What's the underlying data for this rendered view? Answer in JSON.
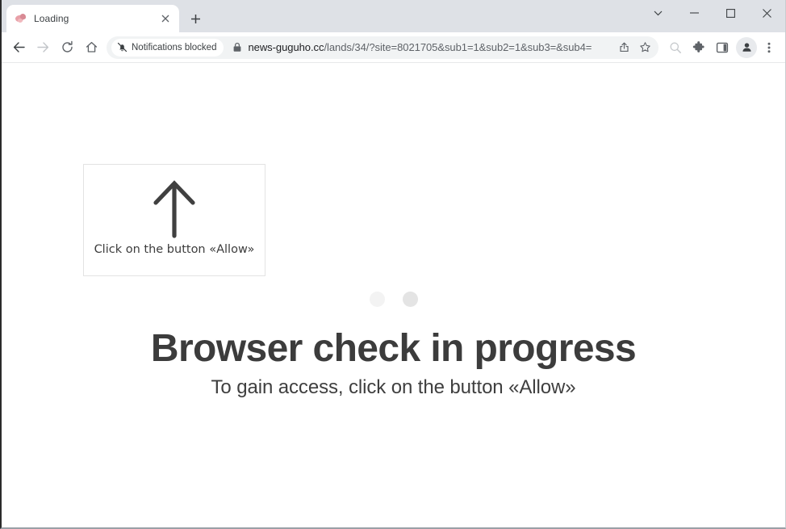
{
  "window": {
    "controls": {
      "tab_search_label": "Search tabs",
      "minimize_label": "Minimize",
      "maximize_label": "Maximize",
      "close_label": "Close"
    }
  },
  "tabstrip": {
    "tabs": [
      {
        "title": "Loading",
        "favicon": "site-favicon",
        "close_label": "Close tab"
      }
    ],
    "new_tab_label": "New Tab"
  },
  "toolbar": {
    "back_label": "Back",
    "forward_label": "Forward",
    "reload_label": "Reload",
    "home_label": "Home",
    "share_label": "Share this page",
    "bookmark_label": "Bookmark this tab",
    "search_label": "Search",
    "extensions_label": "Extensions",
    "side_panel_label": "Side panel",
    "profile_label": "Profile",
    "menu_label": "Customize and control Google Chrome"
  },
  "omnibox": {
    "notifications_chip": "Notifications blocked",
    "notifications_icon": "bell-slash-icon",
    "security_icon": "lock-icon",
    "url_host": "news-guguho.cc",
    "url_path": "/lands/34/?site=8021705&sub1=1&sub2=1&sub3=&sub4=",
    "url_full": "news-guguho.cc/lands/34/?site=8021705&sub1=1&sub2=1&sub3=&sub4="
  },
  "page": {
    "allow_box": {
      "arrow_icon": "arrow-up-icon",
      "caption": "Click on the button «Allow»"
    },
    "loader": {
      "dot_colors": [
        "#f3f3f3",
        "#e4e4e4"
      ]
    },
    "headline": "Browser check in progress",
    "subline": "To gain access, click on the button «Allow»"
  },
  "colors": {
    "tabstrip_bg": "#dee1e6",
    "toolbar_bg": "#ffffff",
    "omnibox_bg": "#f1f3f4",
    "page_bg": "#ffffff",
    "headline_color": "#3c3c3c",
    "box_border": "#e3e3e3",
    "arrow_color": "#404040"
  }
}
